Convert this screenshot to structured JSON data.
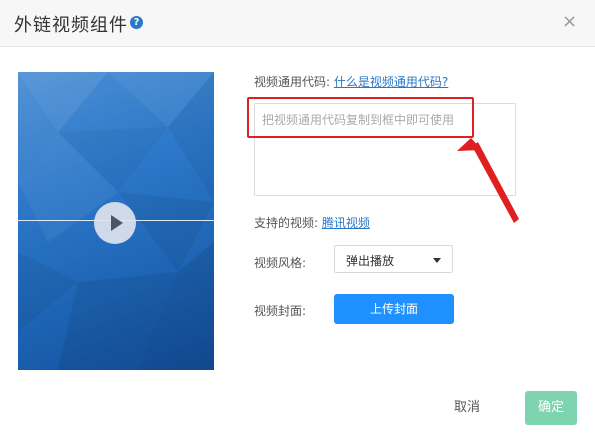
{
  "dialog": {
    "title": "外链视频组件",
    "help_icon": "question-circle-icon",
    "close_icon": "close-icon",
    "close_glyph": "×"
  },
  "video_code": {
    "label": "视频通用代码:",
    "help_link": "什么是视频通用代码?",
    "placeholder": "把视频通用代码复制到框中即可使用",
    "value": ""
  },
  "supported": {
    "label": "支持的视频:",
    "platform_link": "腾讯视频"
  },
  "video_style": {
    "label": "视频风格:",
    "selected": "弹出播放"
  },
  "video_cover": {
    "label": "视频封面:",
    "upload_button": "上传封面"
  },
  "footer": {
    "cancel": "取消",
    "confirm": "确定"
  },
  "colors": {
    "accent_blue": "#1e90ff",
    "confirm_green": "#7fd4b0",
    "annotation_red": "#e02020",
    "link_blue": "#2a78c8"
  }
}
